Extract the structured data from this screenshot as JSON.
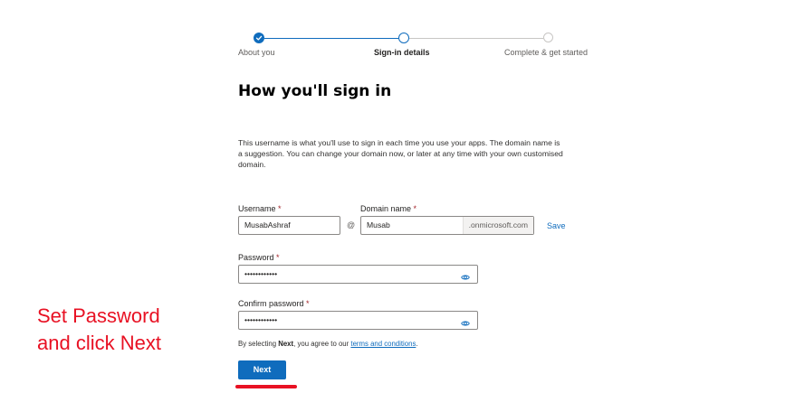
{
  "stepper": {
    "steps": [
      {
        "label": "About you",
        "state": "done"
      },
      {
        "label": "Sign-in details",
        "state": "current"
      },
      {
        "label": "Complete & get started",
        "state": "upcoming"
      }
    ],
    "accent_color": "#0f6cbd"
  },
  "page": {
    "title": "How you'll sign in",
    "description": "This username is what you'll use to sign in each time you use your apps. The domain name is a suggestion. You can change your domain now, or later at any time with your own customised domain."
  },
  "form": {
    "username": {
      "label": "Username",
      "required_mark": "*",
      "value": "MusabAshraf"
    },
    "at_symbol": "@",
    "domain": {
      "label": "Domain name",
      "required_mark": "*",
      "value": "Musab",
      "suffix": ".onmicrosoft.com"
    },
    "save_label": "Save",
    "password": {
      "label": "Password",
      "required_mark": "*",
      "value": "••••••••••••",
      "icon": "eye-icon"
    },
    "confirm_password": {
      "label": "Confirm password",
      "required_mark": "*",
      "value": "••••••••••••",
      "icon": "eye-icon"
    },
    "agreement": {
      "prefix": "By selecting ",
      "bold": "Next",
      "middle": ", you agree to our ",
      "link": "terms and conditions",
      "suffix": "."
    },
    "next_label": "Next"
  },
  "annotation": {
    "line1": "Set Password",
    "line2": "and click Next",
    "color": "#e81123"
  }
}
